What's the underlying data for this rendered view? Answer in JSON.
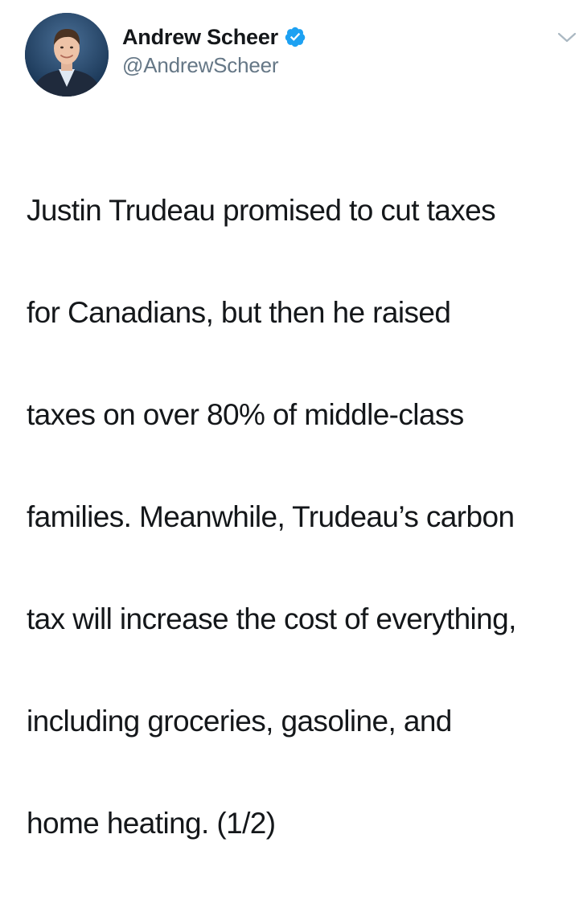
{
  "tweet": {
    "author": {
      "display_name": "Andrew Scheer",
      "handle": "@AndrewScheer",
      "verified": true,
      "avatar_icon": "profile-photo",
      "verified_icon": "verified-badge-icon"
    },
    "menu_icon": "chevron-down-icon",
    "text_lines": [
      "Justin Trudeau promised to cut taxes",
      "for Canadians, but then he raised",
      "taxes on over 80% of middle-class",
      "families. Meanwhile, Trudeau’s carbon",
      "tax will increase the cost of everything,",
      "including groceries, gasoline, and",
      "home heating. (1/2)"
    ]
  },
  "colors": {
    "text": "#14171a",
    "secondary": "#657786",
    "verified": "#1da1f2",
    "chevron": "#aab8c2"
  }
}
